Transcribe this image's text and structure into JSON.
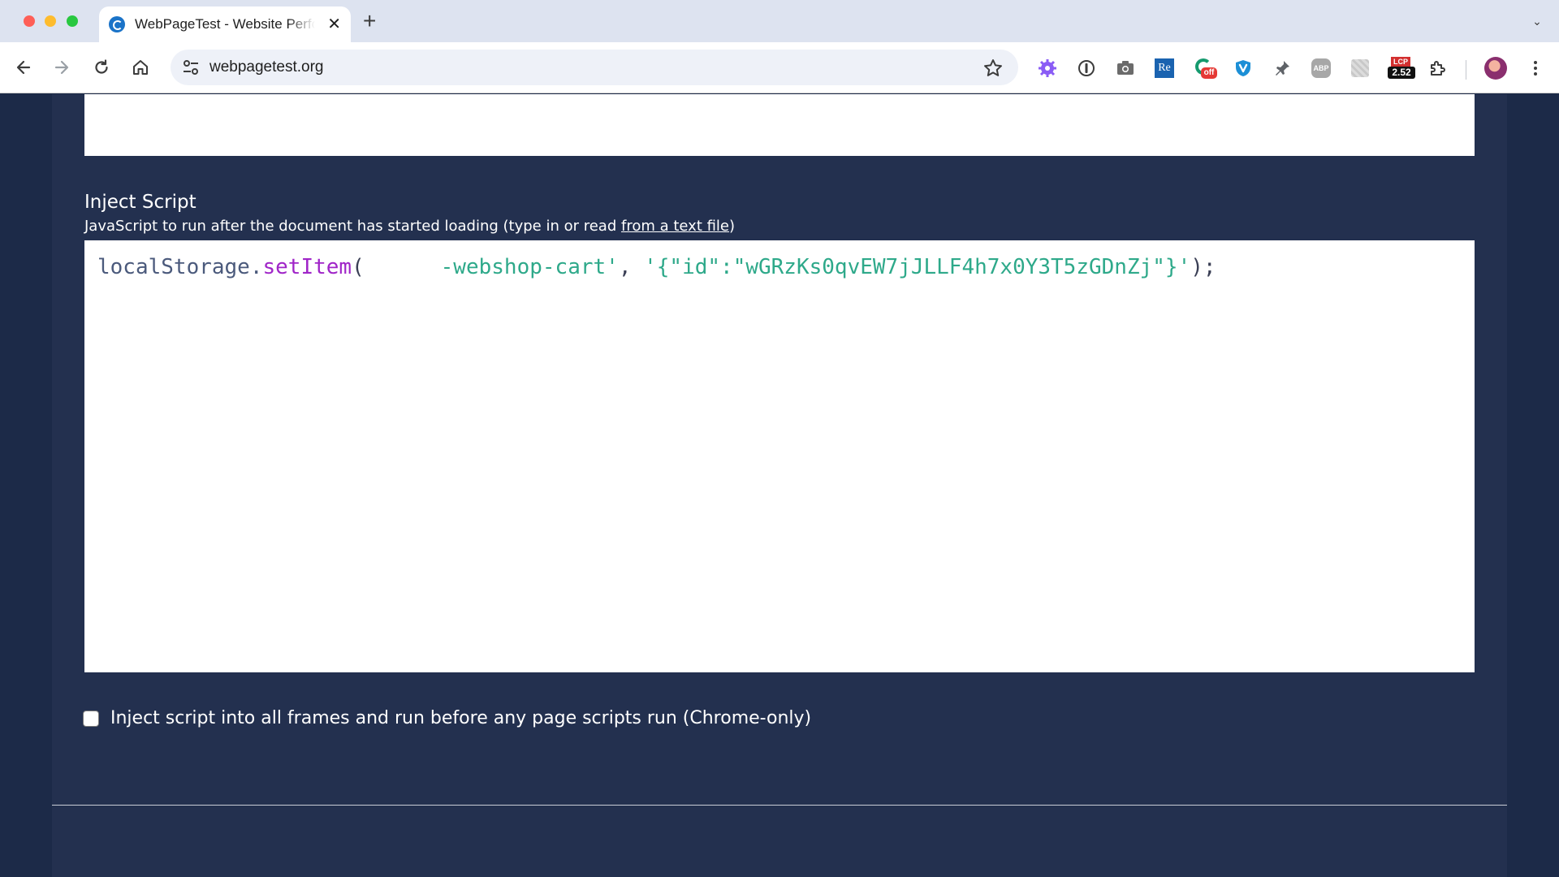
{
  "browser": {
    "tab_title": "WebPageTest - Website Performance and Optimization Test",
    "tab_close": "✕",
    "new_tab": "+",
    "tab_menu": "⌄",
    "url": "webpagetest.org",
    "extensions": {
      "badge_off": "off",
      "lcp_label": "LCP",
      "lcp_value": "2.52",
      "re_label": "Re",
      "abp_label": "ABP"
    }
  },
  "inject_script": {
    "title": "Inject Script",
    "description_prefix": "JavaScript to run after the document has started loading (type in or read ",
    "description_link": "from a text file",
    "description_suffix": ")",
    "code": {
      "object": "localStorage",
      "dot": ".",
      "method": "setItem",
      "open_paren": "(",
      "key_string": "      -webshop-cart'",
      "comma": ", ",
      "value_string": "'{\"id\":\"wGRzKs0qvEW7jJLLF4h7x0Y3T5zGDnZj\"}'",
      "close": ");"
    },
    "checkbox_label": "Inject script into all frames and run before any page scripts run (Chrome-only)",
    "checkbox_checked": false
  },
  "colors": {
    "page_background": "#1c2a48",
    "panel": "#23304f",
    "tabbar": "#dde3f0",
    "code_function": "#a025c8",
    "code_string": "#2ea98a"
  }
}
